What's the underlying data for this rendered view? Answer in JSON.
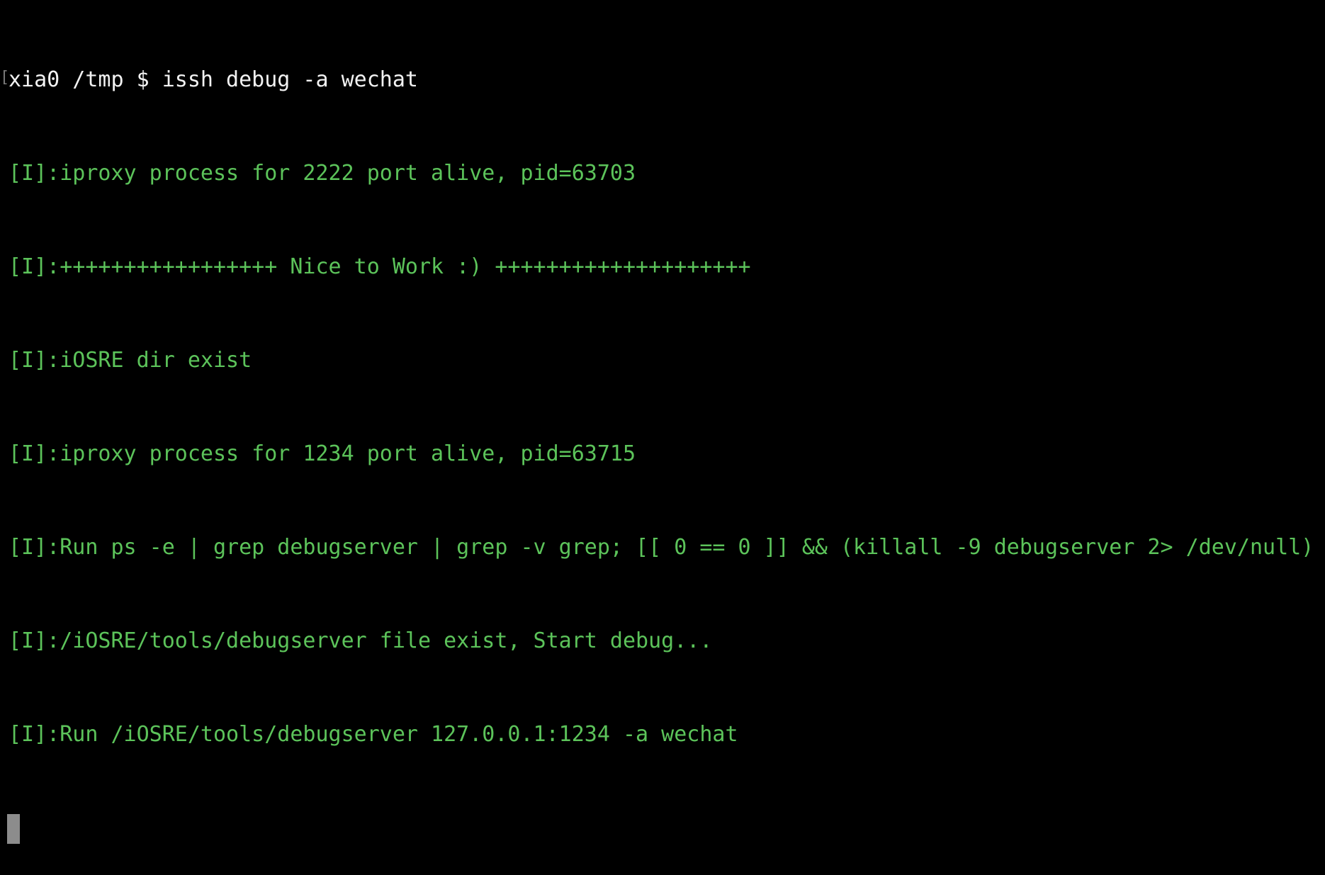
{
  "terminal": {
    "prompt": {
      "bracket": "[",
      "text": "xia0 /tmp $ issh debug -a wechat"
    },
    "lines": [
      "[I]:iproxy process for 2222 port alive, pid=63703",
      "[I]:+++++++++++++++++ Nice to Work :) ++++++++++++++++++++",
      "[I]:iOSRE dir exist",
      "[I]:iproxy process for 1234 port alive, pid=63715",
      "[I]:Run ps -e | grep debugserver | grep -v grep; [[ 0 == 0 ]] && (killall -9 debugserver 2> /dev/null)",
      "[I]:/iOSRE/tools/debugserver file exist, Start debug...",
      "[I]:Run /iOSRE/tools/debugserver 127.0.0.1:1234 -a wechat"
    ],
    "colors": {
      "background": "#000000",
      "prompt": "#f2f2f2",
      "log": "#5cc35a",
      "cursor": "#8c8c8c"
    }
  }
}
